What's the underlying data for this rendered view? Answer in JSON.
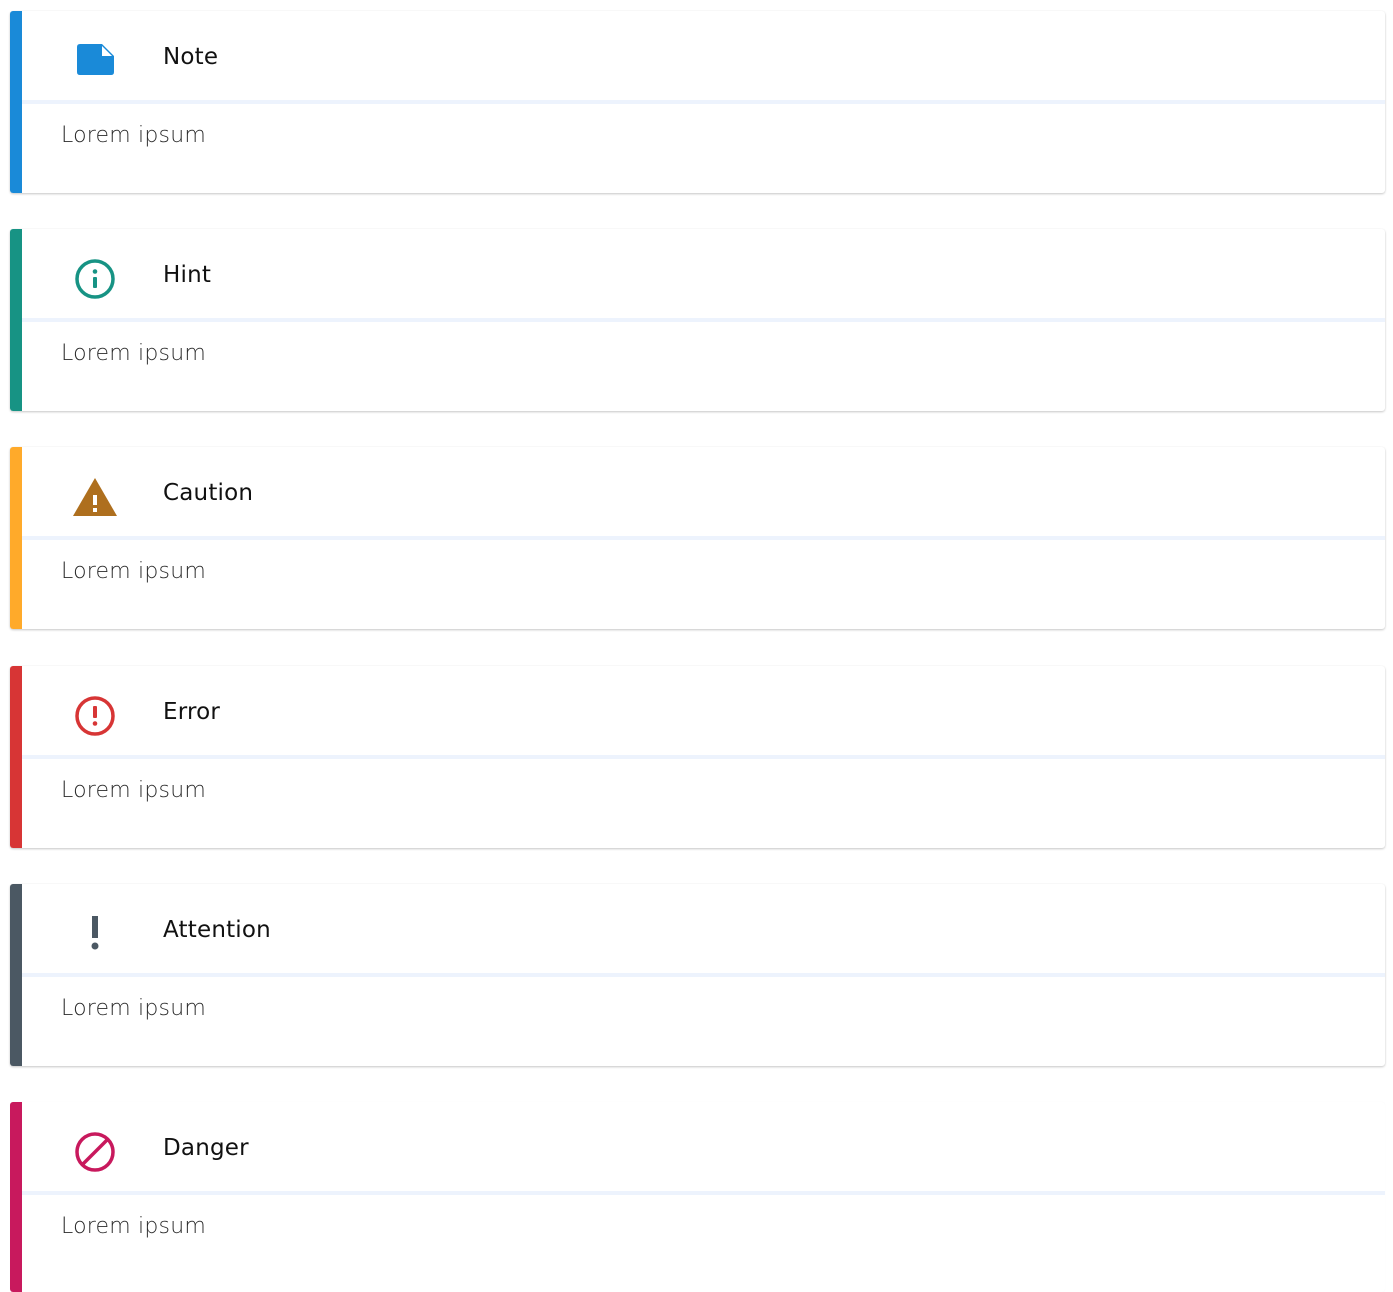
{
  "admonitions": [
    {
      "title": "Note",
      "body": "Lorem ipsum",
      "icon": "note-icon",
      "color": "#1a8ad8"
    },
    {
      "title": "Hint",
      "body": "Lorem ipsum",
      "icon": "info-circle-icon",
      "color": "#179384"
    },
    {
      "title": "Caution",
      "body": "Lorem ipsum",
      "icon": "warning-triangle-icon",
      "color": "#ffaa2a",
      "icon_color": "#ae6f1e"
    },
    {
      "title": "Error",
      "body": "Lorem ipsum",
      "icon": "error-circle-icon",
      "color": "#d73535"
    },
    {
      "title": "Attention",
      "body": "Lorem ipsum",
      "icon": "exclamation-icon",
      "color": "#4b5863"
    },
    {
      "title": "Danger",
      "body": "Lorem ipsum",
      "icon": "block-icon",
      "color": "#c8195d"
    }
  ]
}
